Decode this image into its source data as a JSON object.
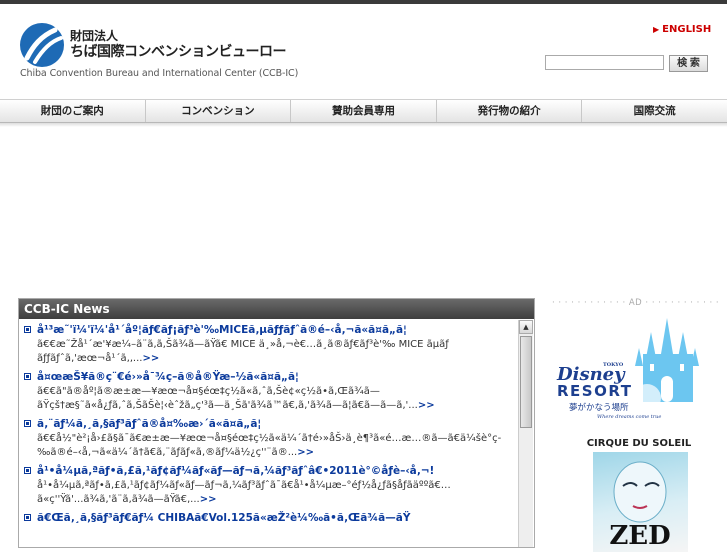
{
  "header": {
    "org_type": "財団法人",
    "org_name": "ちば国際コンベンションビューロー",
    "org_name_en": "Chiba Convention Bureau and International Center (CCB-IC)",
    "english_link": "ENGLISH",
    "search_button": "検 索",
    "search_value": ""
  },
  "nav": {
    "items": [
      {
        "label": "財団のご案内"
      },
      {
        "label": "コンベンション"
      },
      {
        "label": "賛助会員専用"
      },
      {
        "label": "発行物の紹介"
      },
      {
        "label": "国際交流"
      }
    ]
  },
  "news": {
    "heading": "CCB-IC News",
    "items": [
      {
        "title": "å¹³æ˜'ï¼'ï¼'å¹´åº¦ãƒ€ãƒ¡ãƒ³è'‰MICEã‚µãƒƒãƒˆã®é–‹å‚¬ã«ã¤ã„ã¦",
        "body": "ã€€æ˜Žå¹´æ'¥æ¼–ã¨ã‚ã‚Šã¾ã—ãŸã€ MICE ä¸»å‚¬è€…ã¸ã®ãƒ€ãƒ³è'‰ MICE ãµãƒ ãƒƒãƒˆã‚'æœ¬å¹´ã‚‚...",
        "more": ">>"
      },
      {
        "title": "å¤œæŠ¥ã®ç¨€é›»å¯¾ç­–ã®å®Ÿæ–½ã«ã¤ã„ã¦",
        "body": "ã€€ã\"ã®åº¦ã®æ±æ—¥æœ¬å¤§éœ‡ç½ã«ã‚ˆã‚Šè¢«ç½ã•ã‚Œã¾ã—ãŸçš†æ§˜ã«å¿ƒã‚ˆã‚ŠãŠè¦‹èˆžã„ç'³ã—ä¸Šã'ã¾ã™ã€‚ã‚'ã¾ã—ã¦ã€ã—ã—ã‚'...",
        "more": ">>"
      },
      {
        "title": "ã‚¨ãƒ¼ã‚¸ã‚§ãƒ³ãƒˆã®å¤‰æ›´ã«ã¤ã„ã¦",
        "body": "ã€€å½\"è²¡å›£ã§ã¯ã€æ±æ—¥æœ¬å¤§éœ‡ç½ã«ä¼´ã†é›»åŠ›ä¸è¶³ã«é…æ…®ã—ã€ä¼šè­°ç­‰ã®é–‹å‚¬ã«ä¼´ã†ã€ã‚¨ãƒãƒ«ã‚®ãƒ¼ä½¿ç''¨ã®...",
        "more": ">>"
      },
      {
        "title": "å¹•å¼µã‚ªãƒ•ã‚£ã‚¹ãƒ¢ãƒ¼ãƒ«ãƒ—ãƒ¬ã‚¼ãƒ³ãƒˆâ€•2011è°©åƒè–‹å‚¬!",
        "body": "å¹•å¼µã‚ªãƒ•ã‚£ã‚¹ãƒ¢ãƒ¼ãƒ«ãƒ—ãƒ¬ã‚¼ãƒ³ãƒˆã¯ã€å¹•å¼µæ–°éƒ½å¿ƒã§åƒãäººã€…ã«ç''Ÿã'...ã¾ã‚'ã¨ã‚ã¾ã—ãŸã€‚...",
        "more": ">>"
      },
      {
        "title": "ã€Œã‚¸ã‚§ãƒ³ãƒ€ãƒ¼ CHIBAã€Vol.125ã«æŽ²è¼‰ã•ã‚Œã¾ã—ãŸ",
        "body": "",
        "more": ""
      }
    ]
  },
  "sidebar": {
    "ad_label": "AD",
    "disney_text": "TOKYO Disney RESORT",
    "disney_tagline": "夢がかなう場所",
    "disney_subtag": "Where dreams come true",
    "cirque_title": "CIRQUE DU SOLEIL",
    "cirque_show": "ZED"
  },
  "colors": {
    "link": "#0b3a9c",
    "english": "#cc0000",
    "nav_bg": "#e4e4e4",
    "news_header": "#4a4a4a"
  }
}
